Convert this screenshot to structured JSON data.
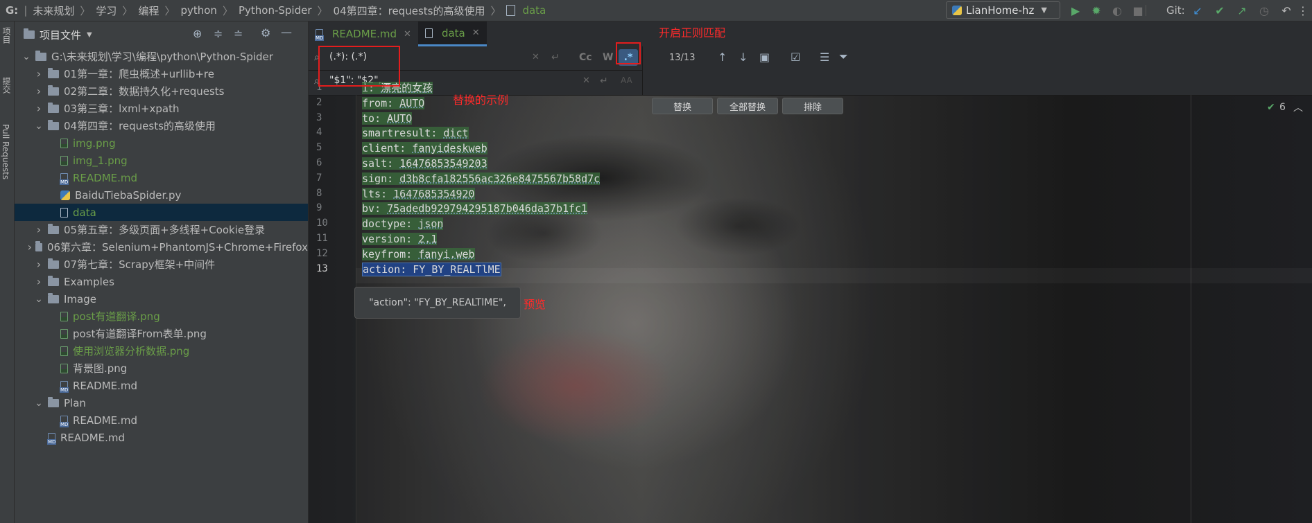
{
  "breadcrumb": {
    "drive": "G:",
    "items": [
      "未来规划",
      "学习",
      "编程",
      "python",
      "Python-Spider",
      "04第四章：requests的高级使用",
      "data"
    ]
  },
  "toolbar": {
    "run_config": "LianHome-hz",
    "git_label": "Git:"
  },
  "left_stripe": {
    "project": "项目",
    "commit": "提交",
    "pull_requests": "Pull Requests"
  },
  "project_panel": {
    "title": "项目文件",
    "tree": [
      {
        "label": "G:\\未来规划\\学习\\编程\\python\\Python-Spider",
        "type": "folder",
        "depth": 0,
        "expanded": true
      },
      {
        "label": "01第一章：爬虫概述+urllib+re",
        "type": "folder",
        "depth": 1,
        "expanded": false
      },
      {
        "label": "02第二章：数据持久化+requests",
        "type": "folder",
        "depth": 1,
        "expanded": false
      },
      {
        "label": "03第三章：lxml+xpath",
        "type": "folder",
        "depth": 1,
        "expanded": false
      },
      {
        "label": "04第四章：requests的高级使用",
        "type": "folder",
        "depth": 1,
        "expanded": true
      },
      {
        "label": "img.png",
        "type": "img",
        "depth": 2,
        "green": true
      },
      {
        "label": "img_1.png",
        "type": "img",
        "depth": 2,
        "green": true
      },
      {
        "label": "README.md",
        "type": "md",
        "depth": 2,
        "green": true
      },
      {
        "label": "BaiduTiebaSpider.py",
        "type": "py",
        "depth": 2
      },
      {
        "label": "data",
        "type": "txt",
        "depth": 2,
        "green": true,
        "selected": true
      },
      {
        "label": "05第五章：多级页面+多线程+Cookie登录",
        "type": "folder",
        "depth": 1,
        "expanded": false
      },
      {
        "label": "06第六章：Selenium+PhantomJS+Chrome+Firefox",
        "type": "folder",
        "depth": 1,
        "expanded": false
      },
      {
        "label": "07第七章：Scrapy框架+中间件",
        "type": "folder",
        "depth": 1,
        "expanded": false
      },
      {
        "label": "Examples",
        "type": "folder",
        "depth": 1,
        "expanded": false
      },
      {
        "label": "Image",
        "type": "folder",
        "depth": 1,
        "expanded": true
      },
      {
        "label": "post有道翻译.png",
        "type": "img",
        "depth": 2,
        "green": true
      },
      {
        "label": "post有道翻译From表单.png",
        "type": "img",
        "depth": 2
      },
      {
        "label": "使用浏览器分析数据.png",
        "type": "img",
        "depth": 2,
        "green": true
      },
      {
        "label": "背景图.png",
        "type": "img",
        "depth": 2
      },
      {
        "label": "README.md",
        "type": "md",
        "depth": 2
      },
      {
        "label": "Plan",
        "type": "folder",
        "depth": 1,
        "expanded": true
      },
      {
        "label": "README.md",
        "type": "md",
        "depth": 2
      },
      {
        "label": "README.md",
        "type": "md",
        "depth": 1
      }
    ]
  },
  "tabs": [
    {
      "label": "README.md",
      "active": false
    },
    {
      "label": "data",
      "active": true
    }
  ],
  "find_replace": {
    "search_value": "(.*): (.*)",
    "replace_value": "\"$1\": \"$2\",",
    "match_case_label": "Cc",
    "words_label": "W",
    "regex_label": ".*",
    "match_count": "13/13",
    "replace_btn": "替换",
    "replace_all_btn": "全部替换",
    "exclude_btn": "排除"
  },
  "editor": {
    "lines": [
      {
        "num": "1",
        "key": "i",
        "value": "漂亮的女孩"
      },
      {
        "num": "2",
        "key": "from",
        "value": "AUTO"
      },
      {
        "num": "3",
        "key": "to",
        "value": "AUTO"
      },
      {
        "num": "4",
        "key": "smartresult",
        "value": "dict"
      },
      {
        "num": "5",
        "key": "client",
        "value": "fanyideskweb"
      },
      {
        "num": "6",
        "key": "salt",
        "value": "16476853549203"
      },
      {
        "num": "7",
        "key": "sign",
        "value": "d3b8cfa182556ac326e8475567b58d7c"
      },
      {
        "num": "8",
        "key": "lts",
        "value": "1647685354920"
      },
      {
        "num": "9",
        "key": "bv",
        "value": "75adedb929794295187b046da37b1fc1"
      },
      {
        "num": "10",
        "key": "doctype",
        "value": "json"
      },
      {
        "num": "11",
        "key": "version",
        "value": "2.1"
      },
      {
        "num": "12",
        "key": "keyfrom",
        "value": "fanyi.web"
      },
      {
        "num": "13",
        "key": "action",
        "value": "FY_BY_REALTlME"
      }
    ],
    "preview_text": "\"action\": \"FY_BY_REALTlME\",",
    "inspection_count": "6"
  },
  "annotations": {
    "regex_note": "开启正则匹配",
    "replace_note": "替换的示例",
    "preview_note": "预览"
  },
  "colors": {
    "match_highlight": "#3a6e3c",
    "selection": "#214283",
    "annotation_red": "#e51d1d",
    "green_vcs": "#6a9e48"
  }
}
